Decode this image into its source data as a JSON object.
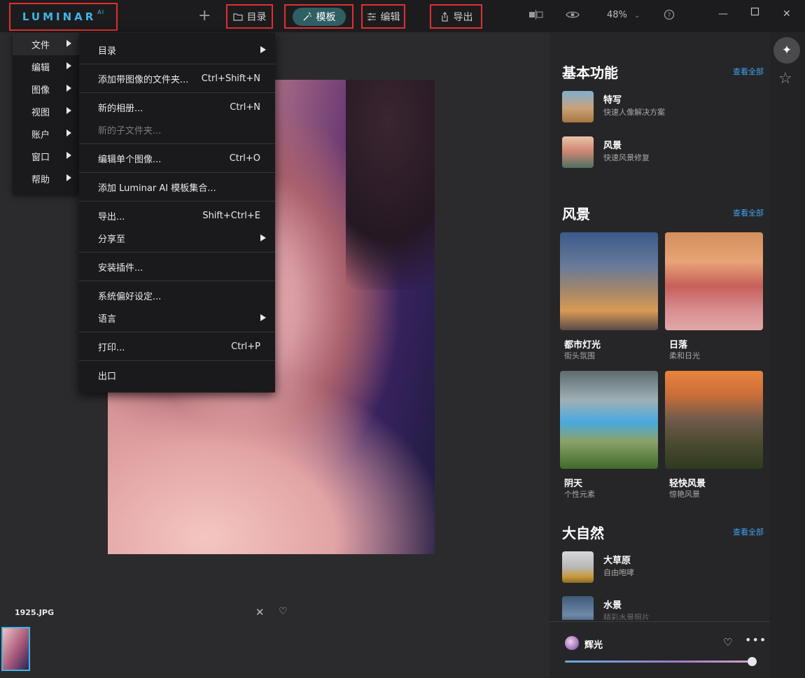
{
  "brand": {
    "name": "LUMINAR",
    "suffix": "AI"
  },
  "toolbar": {
    "catalog": "目录",
    "templates": "模板",
    "edit": "编辑",
    "export": "导出",
    "zoom": "48%"
  },
  "menu_left": [
    "文件",
    "编辑",
    "图像",
    "视图",
    "账户",
    "窗口",
    "帮助"
  ],
  "file_menu": [
    {
      "label": "目录",
      "shortcut": "",
      "submenu": true
    },
    {
      "label": "添加带图像的文件夹...",
      "shortcut": "Ctrl+Shift+N"
    },
    {
      "label": "新的相册...",
      "shortcut": "Ctrl+N"
    },
    {
      "label": "新的子文件夹...",
      "shortcut": "",
      "disabled": true
    },
    {
      "label": "编辑单个图像...",
      "shortcut": "Ctrl+O"
    },
    {
      "label": "添加 Luminar AI 模板集合...",
      "shortcut": ""
    },
    {
      "label": "导出...",
      "shortcut": "Shift+Ctrl+E"
    },
    {
      "label": "分享至",
      "shortcut": "",
      "submenu": true
    },
    {
      "label": "安装插件...",
      "shortcut": ""
    },
    {
      "label": "系统偏好设定...",
      "shortcut": ""
    },
    {
      "label": "语言",
      "shortcut": "",
      "submenu": true
    },
    {
      "label": "打印...",
      "shortcut": "Ctrl+P"
    },
    {
      "label": "出口",
      "shortcut": ""
    }
  ],
  "filename": "1925.JPG",
  "panel": {
    "see_all": "查看全部",
    "basic": {
      "title": "基本功能",
      "items": [
        {
          "name": "特写",
          "desc": "快速人像解决方案"
        },
        {
          "name": "风景",
          "desc": "快速风景修复"
        }
      ]
    },
    "landscape": {
      "title": "风景",
      "cards": [
        {
          "name": "都市灯光",
          "desc": "街头氛围"
        },
        {
          "name": "日落",
          "desc": "柔和日光"
        },
        {
          "name": "阴天",
          "desc": "个性元素"
        },
        {
          "name": "轻快风景",
          "desc": "惊艳风景"
        }
      ]
    },
    "nature": {
      "title": "大自然",
      "items": [
        {
          "name": "大草原",
          "desc": "自由咆哮"
        },
        {
          "name": "水景",
          "desc": "精彩水景照片"
        }
      ]
    },
    "active_template": {
      "name": "辉光",
      "amount": 1.0
    }
  },
  "colors": {
    "accent": "#3fb6e8",
    "highlight_box": "#e0302f",
    "link": "#3fa4f0"
  }
}
